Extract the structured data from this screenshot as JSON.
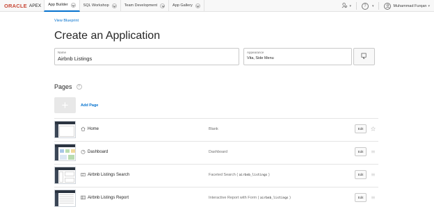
{
  "topbar": {
    "logo_brand": "ORACLE",
    "logo_product": "APEX",
    "tabs": [
      {
        "label": "App Builder",
        "active": true
      },
      {
        "label": "SQL Workshop",
        "active": false
      },
      {
        "label": "Team Development",
        "active": false
      },
      {
        "label": "App Gallery",
        "active": false
      }
    ],
    "user_name": "Muhammad Furqan",
    "icons": [
      "search-people-icon",
      "help-icon",
      "user-icon"
    ]
  },
  "view_blueprint": "View Blueprint",
  "title": "Create an Application",
  "name_field": {
    "label": "Name",
    "value": "Airbnb Listings"
  },
  "appearance_field": {
    "label": "Appearance",
    "value": "Vita, Side Menu"
  },
  "pages_heading": "Pages",
  "add_page": "Add Page",
  "edit_label": "Edit",
  "pages": [
    {
      "name": "Home",
      "type": "Blank",
      "code": "",
      "icon": "home-icon",
      "action_icon": "star-icon"
    },
    {
      "name": "Dashboard",
      "type": "Dashboard",
      "code": "",
      "icon": "dashboard-icon",
      "action_icon": "drag-handle-icon"
    },
    {
      "name": "Airbnb Listings Search",
      "type": "Faceted Search (",
      "code": "airbnb_listings",
      "type_suffix": ")",
      "icon": "search-page-icon",
      "action_icon": "drag-handle-icon"
    },
    {
      "name": "Airbnb Listings Report",
      "type": "Interactive Report with Form (",
      "code": "airbnb_listings",
      "type_suffix": ")",
      "icon": "report-icon",
      "action_icon": "drag-handle-icon"
    }
  ],
  "colors": {
    "accent": "#0572ce",
    "brand": "#c74634"
  }
}
